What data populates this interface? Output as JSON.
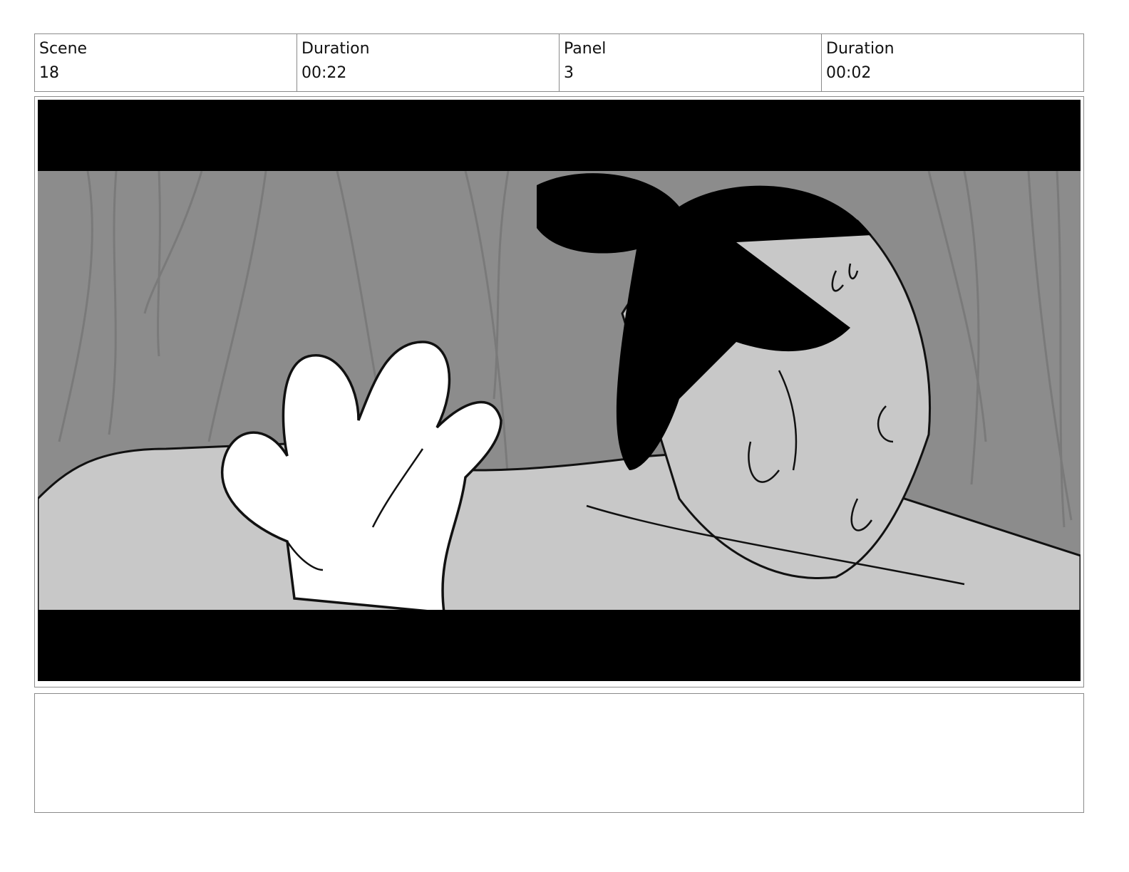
{
  "header": {
    "scene_label": "Scene",
    "scene_value": "18",
    "scene_duration_label": "Duration",
    "scene_duration_value": "00:22",
    "panel_label": "Panel",
    "panel_value": "3",
    "panel_duration_label": "Duration",
    "panel_duration_value": "00:02"
  },
  "panel": {
    "letterbox_color": "#000000",
    "background_color": "#8c8c8c",
    "figure_fill": "#c8c8c8",
    "hand_fill": "#ffffff"
  },
  "notes": {
    "text": ""
  }
}
